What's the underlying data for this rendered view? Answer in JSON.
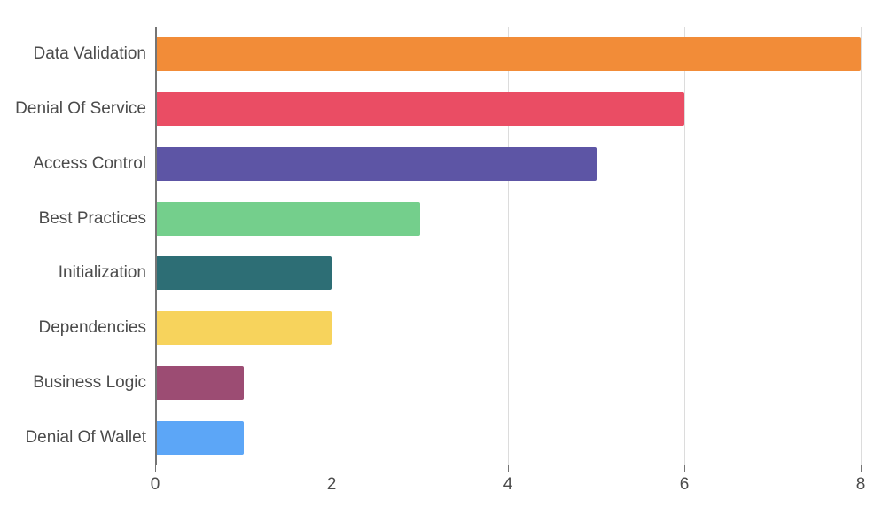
{
  "chart_data": {
    "type": "bar",
    "orientation": "horizontal",
    "categories": [
      "Data Validation",
      "Denial Of Service",
      "Access Control",
      "Best Practices",
      "Initialization",
      "Dependencies",
      "Business Logic",
      "Denial Of Wallet"
    ],
    "values": [
      8,
      6,
      5,
      3,
      2,
      2,
      1,
      1
    ],
    "colors": [
      "#f28c38",
      "#ea4d64",
      "#5d55a5",
      "#74cf8c",
      "#2d6e75",
      "#f7d35c",
      "#9c4c73",
      "#5ca6f7"
    ],
    "title": "",
    "xlabel": "",
    "ylabel": "",
    "xlim": [
      0,
      8
    ],
    "x_ticks": [
      0,
      2,
      4,
      6,
      8
    ],
    "grid": {
      "x": true,
      "y": false
    }
  }
}
